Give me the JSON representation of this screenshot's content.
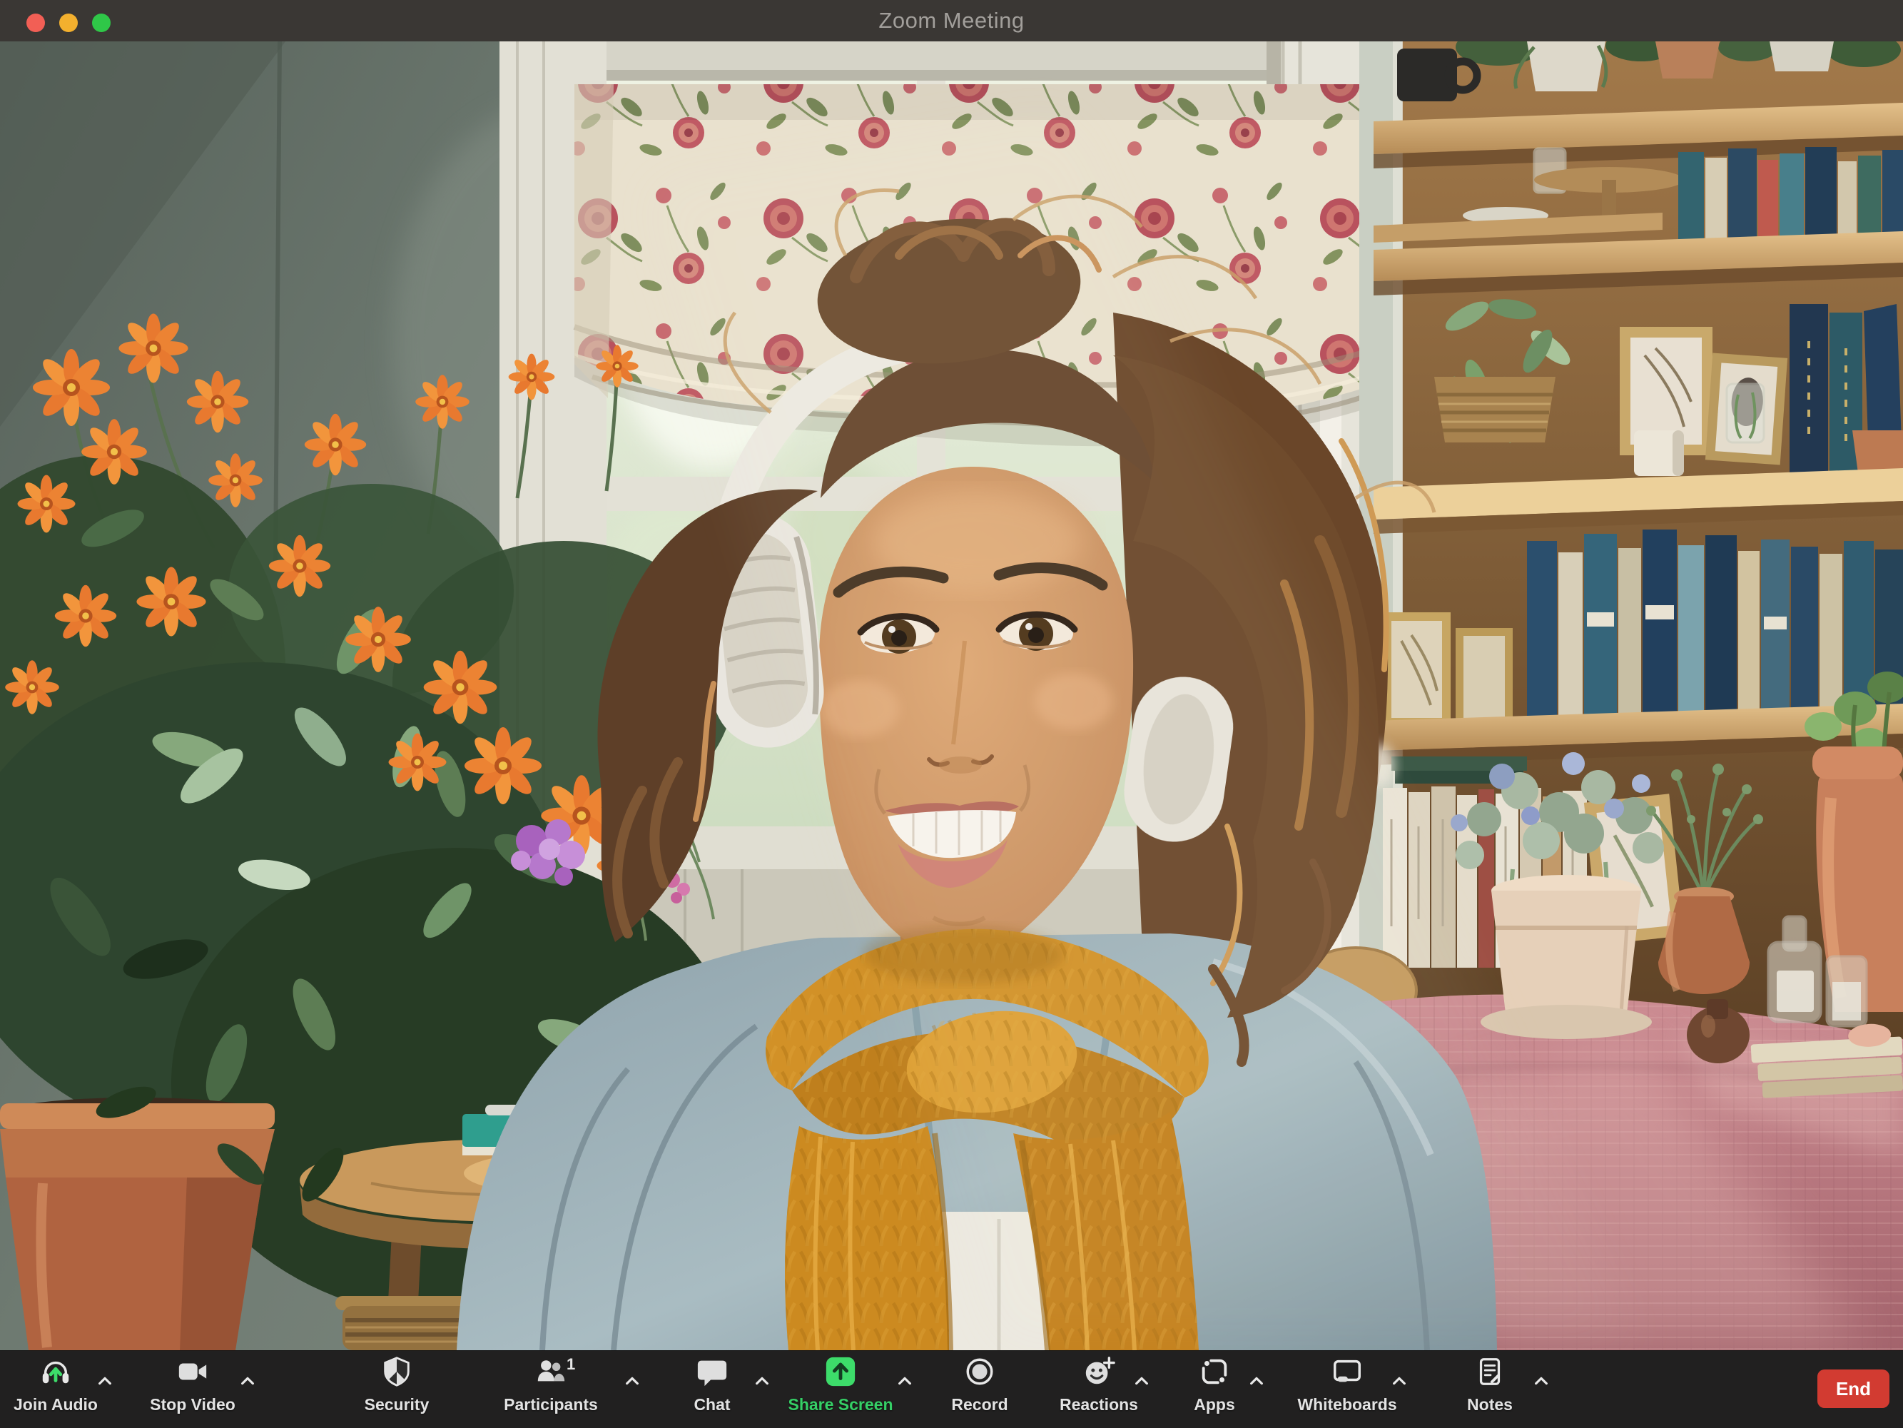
{
  "titlebar": {
    "title": "Zoom Meeting",
    "traffic_lights": {
      "close_color": "#f25f55",
      "minimize_color": "#f3b02e",
      "zoom_color": "#2fc748"
    }
  },
  "video": {
    "participant_visible": true
  },
  "toolbar": {
    "items": [
      {
        "label": "Join Audio",
        "icon": "headphones-icon",
        "chevron": true,
        "accent": "#3ddc6a"
      },
      {
        "label": "Stop Video",
        "icon": "video-camera-icon",
        "chevron": true
      },
      {
        "label": "Security",
        "icon": "shield-icon",
        "chevron": false
      },
      {
        "label": "Participants",
        "icon": "participants-icon",
        "chevron": true,
        "badge": "1"
      },
      {
        "label": "Chat",
        "icon": "chat-bubble-icon",
        "chevron": true
      },
      {
        "label": "Share Screen",
        "icon": "share-screen-icon",
        "chevron": true,
        "active": true,
        "color": "#3ddc6a"
      },
      {
        "label": "Record",
        "icon": "record-icon",
        "chevron": false
      },
      {
        "label": "Reactions",
        "icon": "smiley-plus-icon",
        "chevron": true
      },
      {
        "label": "Apps",
        "icon": "apps-icon",
        "chevron": true
      },
      {
        "label": "Whiteboards",
        "icon": "whiteboard-icon",
        "chevron": true
      },
      {
        "label": "Notes",
        "icon": "notes-icon",
        "chevron": true
      }
    ],
    "end_label": "End",
    "colors": {
      "toolbar_bg": "#212020",
      "share_green": "#3ddc6a",
      "share_label_green": "#35cf66",
      "end_red": "#d23b31",
      "label_gray": "#e3e3e3"
    }
  }
}
